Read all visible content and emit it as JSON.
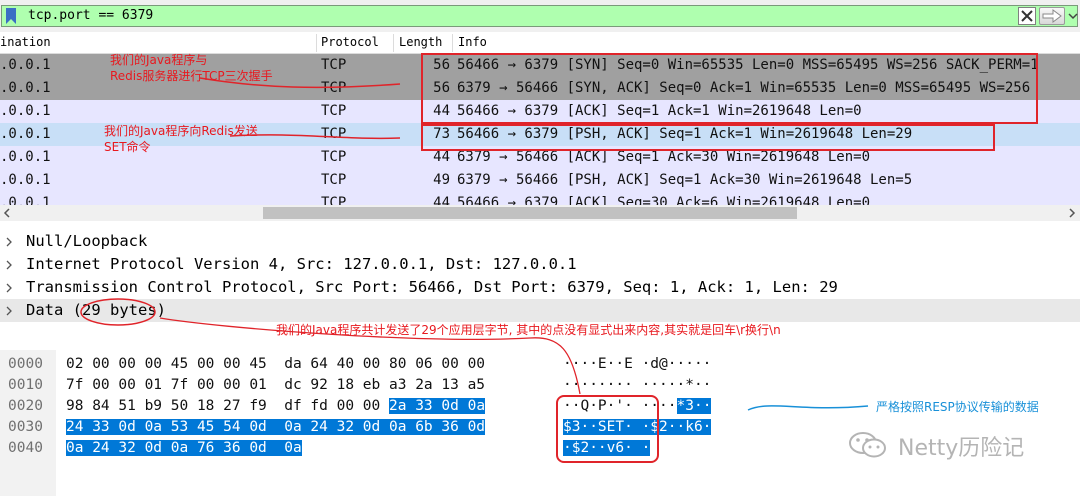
{
  "filter": {
    "expression": "tcp.port == 6379"
  },
  "columns": {
    "destination": "ination",
    "protocol": "Protocol",
    "length": "Length",
    "info": "Info"
  },
  "packets": [
    {
      "dst": ".0.0.1",
      "proto": "TCP",
      "len": "56",
      "info": "56466 → 6379 [SYN] Seq=0 Win=65535 Len=0 MSS=65495 WS=256 SACK_PERM=1",
      "style": "dark"
    },
    {
      "dst": ".0.0.1",
      "proto": "TCP",
      "len": "56",
      "info": "6379 → 56466 [SYN, ACK] Seq=0 Ack=1 Win=65535 Len=0 MSS=65495 WS=256",
      "style": "dark"
    },
    {
      "dst": ".0.0.1",
      "proto": "TCP",
      "len": "44",
      "info": "56466 → 6379 [ACK] Seq=1 Ack=1 Win=2619648 Len=0",
      "style": "lavender"
    },
    {
      "dst": ".0.0.1",
      "proto": "TCP",
      "len": "73",
      "info": "56466 → 6379 [PSH, ACK] Seq=1 Ack=1 Win=2619648 Len=29",
      "style": "selected"
    },
    {
      "dst": ".0.0.1",
      "proto": "TCP",
      "len": "44",
      "info": "6379 → 56466 [ACK] Seq=1 Ack=30 Win=2619648 Len=0",
      "style": "lavender"
    },
    {
      "dst": ".0.0.1",
      "proto": "TCP",
      "len": "49",
      "info": "6379 → 56466 [PSH, ACK] Seq=1 Ack=30 Win=2619648 Len=5",
      "style": "lavender"
    },
    {
      "dst": ".0.0.1",
      "proto": "TCP",
      "len": "44",
      "info": "56466 → 6379 [ACK] Seq=30 Ack=6 Win=2619648 Len=0",
      "style": "lavender"
    }
  ],
  "details": [
    "Null/Loopback",
    "Internet Protocol Version 4, Src: 127.0.0.1, Dst: 127.0.0.1",
    "Transmission Control Protocol, Src Port: 56466, Dst Port: 6379, Seq: 1, Ack: 1, Len: 29",
    "Data (29 bytes)"
  ],
  "bytes": [
    {
      "offset": "0000",
      "hex": "02 00 00 00 45 00 00 45  da 64 40 00 80 06 00 00",
      "hex_sel": "",
      "ascii": "····E··E ·d@·····",
      "ascii_sel": ""
    },
    {
      "offset": "0010",
      "hex": "7f 00 00 01 7f 00 00 01  dc 92 18 eb a3 2a 13 a5",
      "hex_sel": "",
      "ascii": "········ ·····*··",
      "ascii_sel": ""
    },
    {
      "offset": "0020",
      "hex": "98 84 51 b9 50 18 27 f9  df fd 00 00 ",
      "hex_sel": "2a 33 0d 0a",
      "ascii": "··Q·P·'· ····",
      "ascii_sel": "*3··"
    },
    {
      "offset": "0030",
      "hex": "",
      "hex_sel": "24 33 0d 0a 53 45 54 0d  0a 24 32 0d 0a 6b 36 0d",
      "ascii": "",
      "ascii_sel": "$3··SET· ·$2··k6·"
    },
    {
      "offset": "0040",
      "hex": "",
      "hex_sel": "0a 24 32 0d 0a 76 36 0d  0a",
      "ascii": "",
      "ascii_sel": "·$2··v6· ·"
    }
  ],
  "annotations": {
    "handshake": "我们的Java程序与\nRedis服务器进行TCP三次握手",
    "set_cmd": "我们的Java程序向Redis发送\nSET命令",
    "bytes_note": "我们的Java程序共计发送了29个应用层字节, 其中的点没有显式出来内容,其实就是回车\\r换行\\n",
    "resp_note": "严格按照RESP协议传输的数据"
  },
  "watermark": "Netty历险记",
  "colors": {
    "filter_ok": "#afffaf",
    "row_dark": "#a0a0a0",
    "row_lavender": "#e7e6ff",
    "row_selected": "#c8dff7",
    "selection": "#0078d7",
    "annotation_red": "#e8191f",
    "annotation_blue": "#1890d8"
  }
}
